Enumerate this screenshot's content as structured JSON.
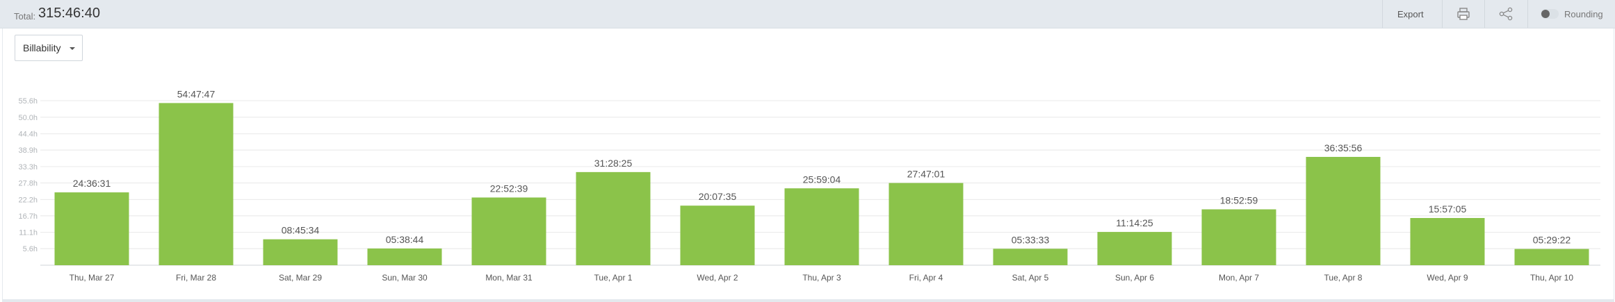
{
  "header": {
    "total_label": "Total:",
    "total_value": "315:46:40",
    "export_label": "Export",
    "print_icon": "print-icon",
    "share_icon": "share-icon",
    "rounding_label": "Rounding",
    "rounding_enabled": false
  },
  "filter": {
    "selected": "Billability"
  },
  "colors": {
    "bar": "#8bc34a",
    "header_bg": "#e4e9ee",
    "grid": "#e8e8e8"
  },
  "chart_data": {
    "type": "bar",
    "categories": [
      "Thu, Mar 27",
      "Fri, Mar 28",
      "Sat, Mar 29",
      "Sun, Mar 30",
      "Mon, Mar 31",
      "Tue, Apr 1",
      "Wed, Apr 2",
      "Thu, Apr 3",
      "Fri, Apr 4",
      "Sat, Apr 5",
      "Sun, Apr 6",
      "Mon, Apr 7",
      "Tue, Apr 8",
      "Wed, Apr 9",
      "Thu, Apr 10"
    ],
    "values": [
      24.61,
      54.8,
      8.76,
      5.65,
      22.88,
      31.47,
      20.13,
      25.98,
      27.78,
      5.56,
      11.24,
      18.88,
      36.6,
      15.95,
      5.49
    ],
    "data_labels": [
      "24:36:31",
      "54:47:47",
      "08:45:34",
      "05:38:44",
      "22:52:39",
      "31:28:25",
      "20:07:35",
      "25:59:04",
      "27:47:01",
      "05:33:33",
      "11:14:25",
      "18:52:59",
      "36:35:56",
      "15:57:05",
      "05:29:22"
    ],
    "yticks": [
      5.6,
      11.1,
      16.7,
      22.2,
      27.8,
      33.3,
      38.9,
      44.4,
      50.0,
      55.6
    ],
    "ytick_labels": [
      "5.6h",
      "11.1h",
      "16.7h",
      "22.2h",
      "27.8h",
      "33.3h",
      "38.9h",
      "44.4h",
      "50.0h",
      "55.6h"
    ],
    "ylim": [
      0,
      55.6
    ],
    "title": "",
    "xlabel": "",
    "ylabel": "",
    "grid": true
  }
}
